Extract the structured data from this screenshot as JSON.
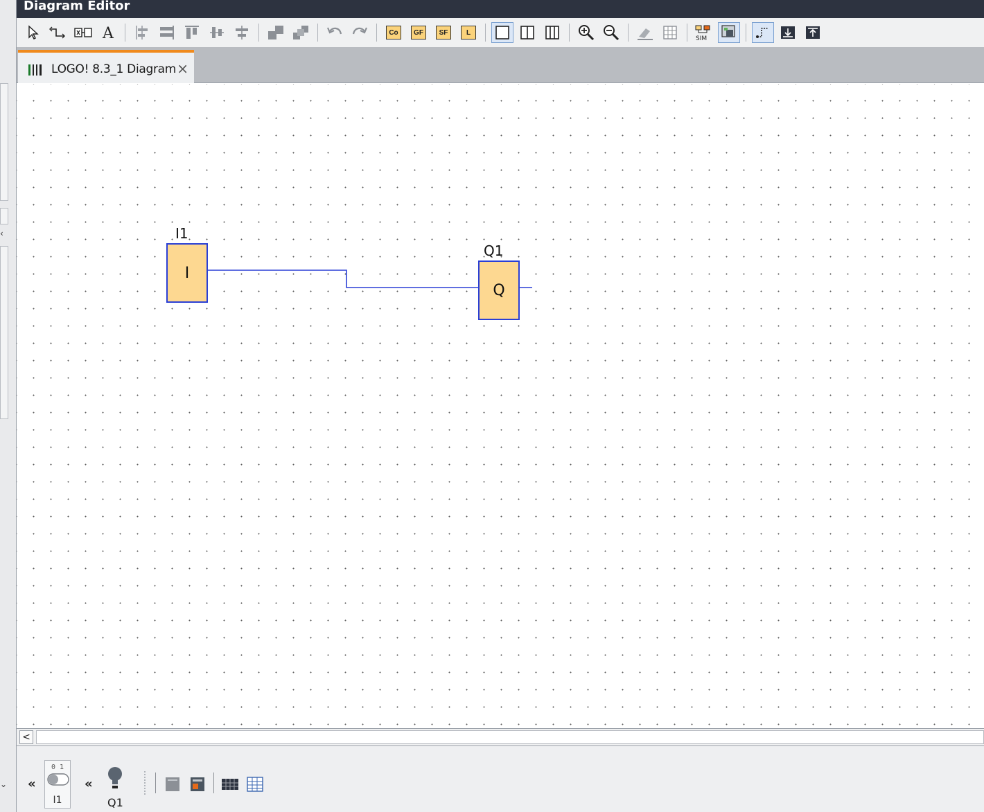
{
  "window": {
    "title": "Diagram Editor"
  },
  "toolbar": {
    "groups": [
      [
        "select-icon",
        "connect-icon",
        "cut-connect-icon",
        "text-icon"
      ],
      [
        "align-left-icon",
        "align-vertical-icon",
        "align-top-icon",
        "align-horizontal-icon",
        "distribute-icon"
      ],
      [
        "group-icon",
        "ungroup-icon"
      ],
      [
        "undo-icon",
        "redo-icon"
      ],
      [
        "Co",
        "GF",
        "SF",
        "L"
      ],
      [
        "single-page-icon",
        "two-column-icon",
        "three-column-icon"
      ],
      [
        "zoom-in-icon",
        "zoom-out-icon"
      ],
      [
        "eraser-icon",
        "table-icon"
      ],
      [
        "simulation-icon",
        "online-test-icon"
      ],
      [
        "route-icon",
        "expand-icon",
        "collapse-icon"
      ]
    ],
    "block_buttons": {
      "co": "Co",
      "gf": "GF",
      "sf": "SF",
      "l": "L"
    }
  },
  "tab": {
    "label": "LOGO! 8.3_1 Diagram",
    "close": "×"
  },
  "diagram": {
    "blocks": [
      {
        "id": "I1",
        "name": "I1",
        "symbol": "I",
        "type": "input"
      },
      {
        "id": "Q1",
        "name": "Q1",
        "symbol": "Q",
        "type": "output"
      }
    ],
    "connections": [
      {
        "from": "I1",
        "to": "Q1"
      }
    ]
  },
  "scrollbar": {
    "left_arrow": "<"
  },
  "bottombar": {
    "chevron": "«",
    "input": {
      "label": "I1",
      "switch_digits": "0 1"
    },
    "output": {
      "label": "Q1"
    }
  },
  "colors": {
    "block_fill": "#fdd891",
    "block_border": "#2a3fd6",
    "wire": "#2a3fd6",
    "titlebar": "#2d3340",
    "tab_accent": "#f08a1c"
  }
}
